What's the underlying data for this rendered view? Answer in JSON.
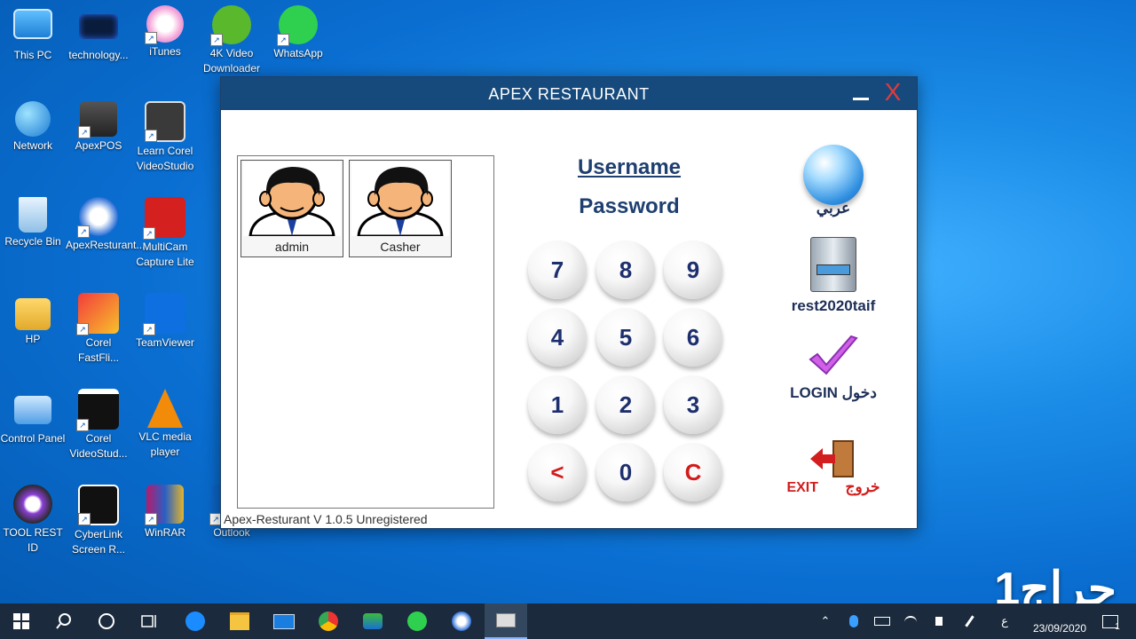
{
  "desktop": {
    "icons": [
      {
        "label": "This PC"
      },
      {
        "label": "technology..."
      },
      {
        "label": "iTunes"
      },
      {
        "label": "4K Video Downloader"
      },
      {
        "label": "WhatsApp"
      },
      {
        "label": "Network"
      },
      {
        "label": "ApexPOS"
      },
      {
        "label": "Learn Corel VideoStudio"
      },
      {
        "label": "Recycle Bin"
      },
      {
        "label": "ApexResturant..."
      },
      {
        "label": "MultiCam Capture Lite"
      },
      {
        "label": "HP"
      },
      {
        "label": "Corel FastFli..."
      },
      {
        "label": "TeamViewer"
      },
      {
        "label": "Control Panel"
      },
      {
        "label": "Corel VideoStud..."
      },
      {
        "label": "VLC media player"
      },
      {
        "label": "TOOL REST ID"
      },
      {
        "label": "CyberLink Screen R..."
      },
      {
        "label": "WinRAR"
      },
      {
        "label": "Outlook"
      }
    ]
  },
  "window": {
    "title": "APEX RESTAURANT",
    "close_glyph": "X",
    "users": [
      {
        "name": "admin"
      },
      {
        "name": "Casher"
      }
    ],
    "username_label": "Username",
    "password_label": "Password",
    "keypad": [
      "7",
      "8",
      "9",
      "4",
      "5",
      "6",
      "1",
      "2",
      "3",
      "<",
      "0",
      "C"
    ],
    "side": {
      "arabic_label": "عربي",
      "db_label": "rest2020taif",
      "login_label": "LOGIN  دخول",
      "exit_en": "EXIT",
      "exit_ar": "خروج"
    },
    "status": "Apex-Resturant V 1.0.5 Unregistered"
  },
  "taskbar": {
    "date": "23/09/2020",
    "notif_count": "1",
    "lang": "ع"
  },
  "watermark": "حراج1"
}
